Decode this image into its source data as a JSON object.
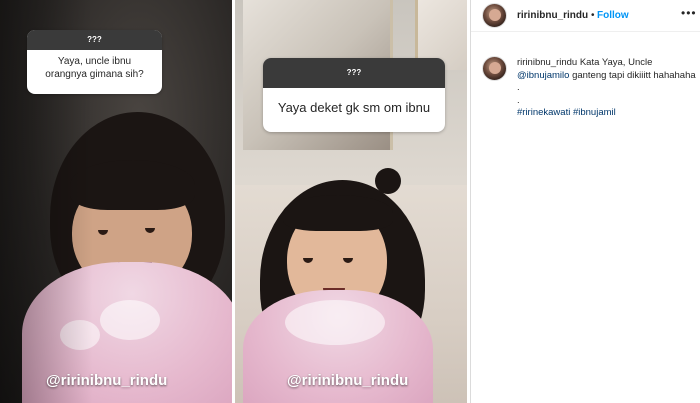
{
  "left_story": {
    "question_header": "???",
    "question_text": "Yaya, uncle ibnu orangnya gimana sih?",
    "watermark": "@ririnibnu_rindu"
  },
  "mid_story": {
    "question_header": "???",
    "question_text": "Yaya deket gk sm om ibnu",
    "watermark": "@ririnibnu_rindu"
  },
  "post": {
    "header": {
      "username": "ririnibnu_rindu",
      "separator": "•",
      "follow_label": "Follow",
      "more_icon": "more-horizontal-icon"
    },
    "caption": {
      "username": "ririnibnu_rindu",
      "text_1": "Kata Yaya, Uncle",
      "mention": "@ibnujamilo",
      "text_2": "ganteng tapi dikiiitt hahahaha",
      "dot_1": ".",
      "dot_2": ".",
      "hashtag_1": "#ririnekawati",
      "hashtag_2": "#ibnujamil"
    }
  },
  "colors": {
    "follow_blue": "#0095f6",
    "link_blue": "#00376b",
    "text_dark": "#262626"
  }
}
